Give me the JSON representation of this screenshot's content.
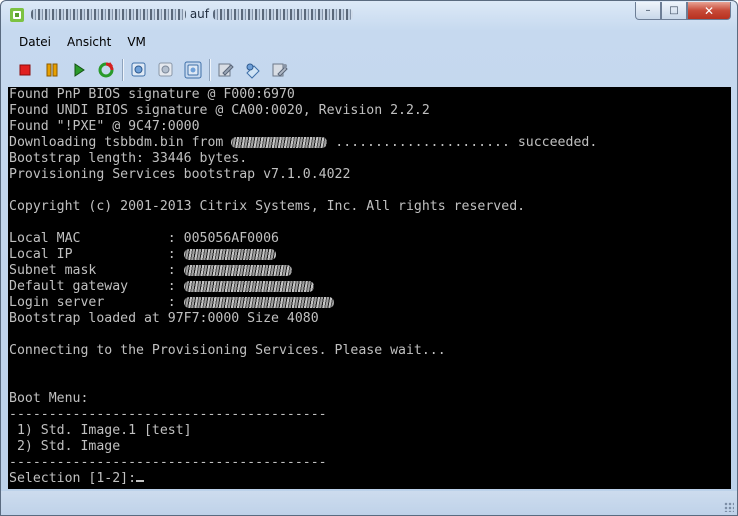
{
  "window": {
    "title_word": "auf",
    "controls": {
      "minimize": "–",
      "maximize": "□",
      "close": "✕"
    }
  },
  "menu": {
    "items": [
      {
        "label": "Datei"
      },
      {
        "label": "Ansicht"
      },
      {
        "label": "VM"
      }
    ]
  },
  "toolbar": {
    "icons": [
      "stop-icon",
      "pause-icon",
      "play-icon",
      "reset-icon",
      "snapshot-icon",
      "revert-snapshot-icon",
      "manage-snapshots-icon",
      "settings-icon",
      "network-adapter-icon",
      "tools-icon"
    ]
  },
  "console": {
    "lines": {
      "l0": "Found PnP BIOS signature @ F000:6970",
      "l1": "Found UNDI BIOS signature @ CA00:0020, Revision 2.2.2",
      "l2": "Found \"!PXE\" @ 9C47:0000",
      "l3a": "Downloading tsbbdm.bin from ",
      "l3b": " ...................... succeeded.",
      "l4": "Bootstrap length: 33446 bytes.",
      "l5": "Provisioning Services bootstrap v7.1.0.4022",
      "l7": "Copyright (c) 2001-2013 Citrix Systems, Inc. All rights reserved.",
      "l9": "Local MAC           : 005056AF0006",
      "l10": "Local IP            : ",
      "l11": "Subnet mask         : ",
      "l12": "Default gateway     : ",
      "l13": "Login server        : ",
      "l14": "Bootstrap loaded at 97F7:0000 Size 4080",
      "l16": "Connecting to the Provisioning Services. Please wait...",
      "l19": "Boot Menu:",
      "l20": "----------------------------------------",
      "l21": " 1) Std. Image.1 [test]",
      "l22": " 2) Std. Image",
      "l23": "----------------------------------------",
      "l24": "Selection [1-2]:"
    }
  },
  "colors": {
    "console_bg": "#000000",
    "console_fg": "#c0c0c0",
    "stop": "#e02020",
    "pause": "#e8a000",
    "play": "#2a9a2a"
  }
}
